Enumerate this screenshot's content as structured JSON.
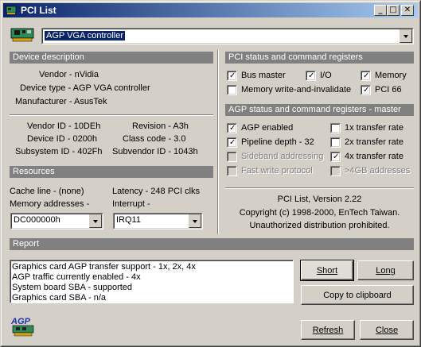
{
  "window": {
    "title": "PCI List"
  },
  "titlebar_buttons": {
    "minimize": "_",
    "maximize": "□",
    "close": "✕"
  },
  "device_select": {
    "value": "AGP VGA controller"
  },
  "device_description": {
    "header": "Device description",
    "vendor": "Vendor - nVidia",
    "device_type": "Device type - AGP VGA controller",
    "manufacturer": "Manufacturer - AsusTek",
    "vendor_id": "Vendor ID - 10DEh",
    "device_id": "Device ID - 0200h",
    "subsystem_id": "Subsystem ID - 402Fh",
    "revision": "Revision - A3h",
    "class_code": "Class code - 3.0",
    "subvendor_id": "Subvendor ID - 1043h"
  },
  "resources": {
    "header": "Resources",
    "cache_line": "Cache line - (none)",
    "latency": "Latency - 248 PCI clks",
    "memory_label": "Memory addresses -",
    "memory_value": "DC000000h",
    "interrupt_label": "Interrupt -",
    "interrupt_value": "IRQ11"
  },
  "pci_status": {
    "header": "PCI status and command registers",
    "items": [
      {
        "label": "Bus master",
        "checked": true
      },
      {
        "label": "I/O",
        "checked": true
      },
      {
        "label": "Memory",
        "checked": true
      },
      {
        "label": "Memory write-and-invalidate",
        "checked": false
      },
      {
        "label": "PCI 66",
        "checked": true
      }
    ]
  },
  "agp_status": {
    "header": "AGP status and command registers - master",
    "items": [
      {
        "label": "AGP enabled",
        "checked": true,
        "disabled": false
      },
      {
        "label": "1x transfer rate",
        "checked": false,
        "disabled": false
      },
      {
        "label": "Pipeline depth - 32",
        "checked": true,
        "disabled": false
      },
      {
        "label": "2x transfer rate",
        "checked": false,
        "disabled": false
      },
      {
        "label": "Sideband addressing",
        "checked": false,
        "disabled": true
      },
      {
        "label": "4x transfer rate",
        "checked": true,
        "disabled": false
      },
      {
        "label": "Fast write protocol",
        "checked": false,
        "disabled": true
      },
      {
        "label": ">4GB addresses",
        "checked": false,
        "disabled": true
      }
    ]
  },
  "about": {
    "line1": "PCI List, Version 2.22",
    "line2": "Copyright (c) 1998-2000, EnTech Taiwan.",
    "line3": "Unauthorized distribution prohibited."
  },
  "report": {
    "header": "Report",
    "lines": [
      "Graphics card AGP transfer support - 1x, 2x, 4x",
      "AGP traffic currently enabled - 4x",
      "System board SBA - supported",
      "Graphics card SBA - n/a"
    ]
  },
  "buttons": {
    "short": "Short",
    "long": "Long",
    "copy": "Copy to clipboard",
    "refresh": "Refresh",
    "close": "Close"
  },
  "logo": {
    "text": "AGP"
  },
  "colors": {
    "title_start": "#0a246a",
    "title_end": "#a6caf0",
    "section_header": "#808080",
    "face": "#d4d0c8",
    "selection": "#0a246a"
  },
  "icons": {
    "app": "pci-card-icon",
    "logo": "agp-logo-icon"
  }
}
